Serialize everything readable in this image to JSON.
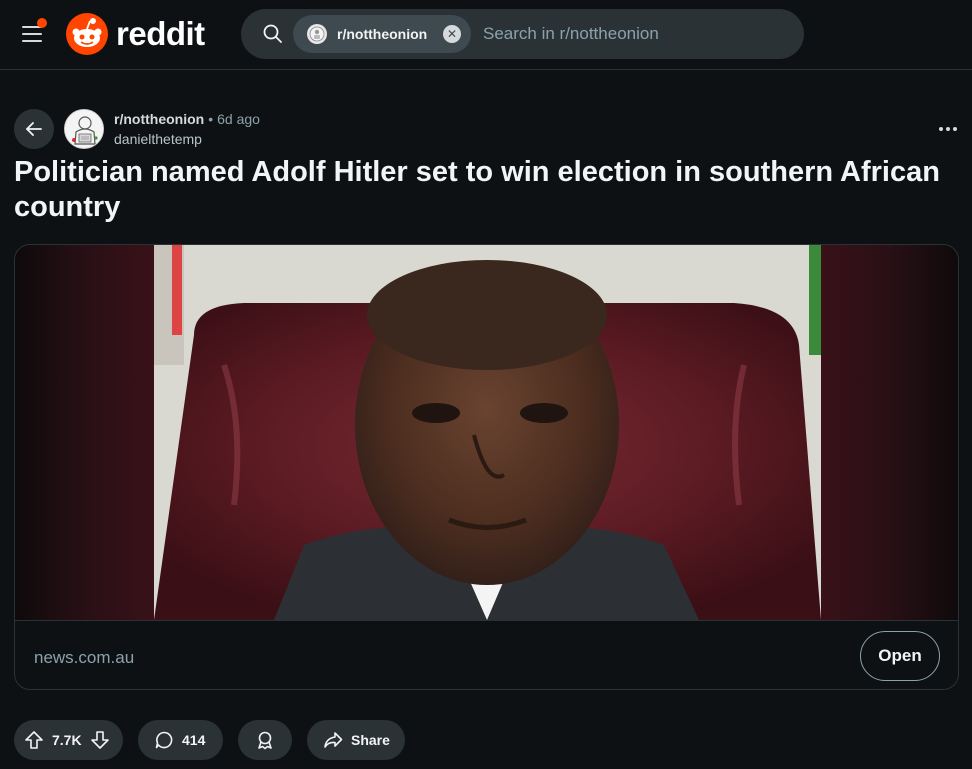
{
  "header": {
    "logo_text": "reddit",
    "brand_color": "#ff4500",
    "search": {
      "chip_label": "r/nottheonion",
      "placeholder": "Search in r/nottheonion"
    }
  },
  "post": {
    "subreddit": "r/nottheonion",
    "separator": "•",
    "age": "6d ago",
    "author": "danielthetemp",
    "title": "Politician named Adolf Hitler set to win election in southern African country",
    "link": {
      "domain": "news.com.au",
      "open_label": "Open"
    },
    "actions": {
      "upvotes": "7.7K",
      "comments": "414",
      "share_label": "Share"
    }
  },
  "icons": {
    "menu": "menu-icon",
    "search": "search-icon",
    "back": "arrow-left-icon",
    "more": "more-horizontal-icon",
    "upvote": "arrow-up-icon",
    "downvote": "arrow-down-icon",
    "comment": "comment-icon",
    "award": "award-icon",
    "share": "share-icon"
  }
}
